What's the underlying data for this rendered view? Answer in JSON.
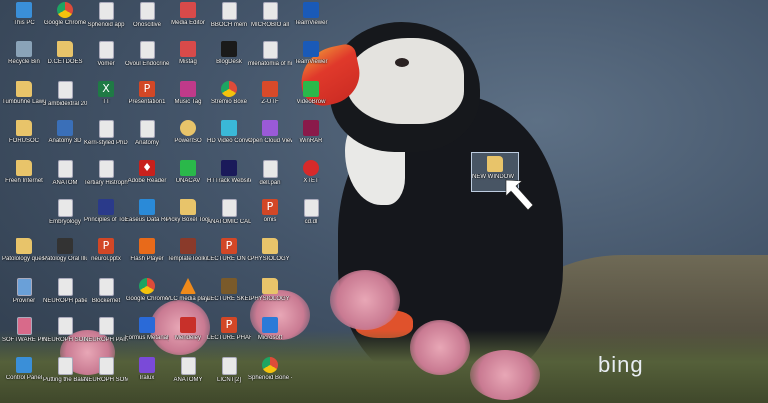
{
  "wallpaper": {
    "brand": "bing"
  },
  "icons": [
    {
      "label": "This PC",
      "icon": "computer-icon",
      "color": "#3a8fd8",
      "col": 0,
      "row": 0
    },
    {
      "label": "Recycle Bin",
      "icon": "recycle-bin-icon",
      "color": "#8aa3b8",
      "col": 0,
      "row": 1
    },
    {
      "label": "Tumbuhne Lawuse",
      "icon": "folder-icon",
      "color": "#e8c46a",
      "col": 0,
      "row": 2
    },
    {
      "label": "FORUSOC",
      "icon": "folder-icon",
      "color": "#e8c46a",
      "col": 0,
      "row": 3
    },
    {
      "label": "Freeh Internet",
      "icon": "folder-icon",
      "color": "#e8c46a",
      "col": 0,
      "row": 4
    },
    {
      "label": "Patolology questions",
      "icon": "folder-icon",
      "color": "#e8c46a",
      "col": 0,
      "row": 6
    },
    {
      "label": "Proviner",
      "icon": "document-icon",
      "color": "#6aa0d8",
      "col": 0,
      "row": 7
    },
    {
      "label": "SOFTWARE PHISC",
      "icon": "document-icon",
      "color": "#d86a8a",
      "col": 0,
      "row": 8
    },
    {
      "label": "Control Panel",
      "icon": "control-panel-icon",
      "color": "#3a8fd8",
      "col": 0,
      "row": 9
    },
    {
      "label": "Google Chrome",
      "icon": "chrome-icon",
      "color": "#dd4b39",
      "col": 1,
      "row": 0
    },
    {
      "label": "D.CETDOES",
      "icon": "folder-icon",
      "color": "#e8c46a",
      "col": 1,
      "row": 1
    },
    {
      "label": "3 ambidextral 2017",
      "icon": "document-icon",
      "color": "#e8e8e8",
      "col": 1,
      "row": 2
    },
    {
      "label": "Anatomy 3D",
      "icon": "app-icon",
      "color": "#3a6fb8",
      "col": 1,
      "row": 3
    },
    {
      "label": "ANATOM",
      "icon": "document-icon",
      "color": "#e8e8e8",
      "col": 1,
      "row": 4
    },
    {
      "label": "Embryology",
      "icon": "document-icon",
      "color": "#e8e8e8",
      "col": 1,
      "row": 5
    },
    {
      "label": "Patology Oral Illus copy",
      "icon": "image-icon",
      "color": "#333333",
      "col": 1,
      "row": 6
    },
    {
      "label": "NEUROPH patient",
      "icon": "document-icon",
      "color": "#e8e8e8",
      "col": 1,
      "row": 7
    },
    {
      "label": "NEUROPH SOMATIC",
      "icon": "document-icon",
      "color": "#e8e8e8",
      "col": 1,
      "row": 8
    },
    {
      "label": "Putting the Balance",
      "icon": "document-icon",
      "color": "#e8e8e8",
      "col": 1,
      "row": 9
    },
    {
      "label": "Sphenoid app",
      "icon": "document-icon",
      "color": "#e8e8e8",
      "col": 2,
      "row": 0
    },
    {
      "label": "Vomer",
      "icon": "document-icon",
      "color": "#e8e8e8",
      "col": 2,
      "row": 1
    },
    {
      "label": "TT",
      "icon": "excel-icon",
      "color": "#1f7a45",
      "col": 2,
      "row": 2
    },
    {
      "label": "Kerri-styled PhD stuff",
      "icon": "document-icon",
      "color": "#e8e8e8",
      "col": 2,
      "row": 3
    },
    {
      "label": "Tertiary Histrophy",
      "icon": "document-icon",
      "color": "#e8e8e8",
      "col": 2,
      "row": 4
    },
    {
      "label": "Principles of Toxicology",
      "icon": "image-icon",
      "color": "#2a3a8a",
      "col": 2,
      "row": 5
    },
    {
      "label": "neurol.pptx",
      "icon": "powerpoint-icon",
      "color": "#d24726",
      "col": 2,
      "row": 6
    },
    {
      "label": "Blockernet",
      "icon": "document-icon",
      "color": "#e8e8e8",
      "col": 2,
      "row": 7
    },
    {
      "label": "NEUROPH PAIN",
      "icon": "document-icon",
      "color": "#e8e8e8",
      "col": 2,
      "row": 8
    },
    {
      "label": "NEUROPH SOMATIC",
      "icon": "document-icon",
      "color": "#e8e8e8",
      "col": 2,
      "row": 9
    },
    {
      "label": "Onoscitive",
      "icon": "document-icon",
      "color": "#e8e8e8",
      "col": 3,
      "row": 0
    },
    {
      "label": "Ovoul Endocrine",
      "icon": "document-icon",
      "color": "#e8e8e8",
      "col": 3,
      "row": 1
    },
    {
      "label": "Presentation1",
      "icon": "powerpoint-icon",
      "color": "#d24726",
      "col": 3,
      "row": 2
    },
    {
      "label": "Anatomy",
      "icon": "document-icon",
      "color": "#e8e8e8",
      "col": 3,
      "row": 3
    },
    {
      "label": "Adobe Reader",
      "icon": "pdf-icon",
      "color": "#c8201c",
      "col": 3,
      "row": 4
    },
    {
      "label": "Easeus Data Recovery",
      "icon": "app-icon",
      "color": "#2a8ad8",
      "col": 3,
      "row": 5
    },
    {
      "label": "Flash Player",
      "icon": "app-icon",
      "color": "#e86a1a",
      "col": 3,
      "row": 6
    },
    {
      "label": "Google Chrome",
      "icon": "chrome-icon",
      "color": "#dd4b39",
      "col": 3,
      "row": 7
    },
    {
      "label": "Formus Metanalysis",
      "icon": "app-icon",
      "color": "#2a6ad8",
      "col": 3,
      "row": 8
    },
    {
      "label": "Iralux",
      "icon": "app-icon",
      "color": "#7a4ad8",
      "col": 3,
      "row": 9
    },
    {
      "label": "Media Editor",
      "icon": "app-icon",
      "color": "#d84a4a",
      "col": 4,
      "row": 0
    },
    {
      "label": "Mistag",
      "icon": "app-icon",
      "color": "#d84a4a",
      "col": 4,
      "row": 1
    },
    {
      "label": "Music Tag",
      "icon": "app-icon",
      "color": "#c03a8a",
      "col": 4,
      "row": 2
    },
    {
      "label": "PowerISO",
      "icon": "disc-icon",
      "color": "#e8c46a",
      "col": 4,
      "row": 3
    },
    {
      "label": "UNACAV",
      "icon": "app-icon",
      "color": "#2ab84a",
      "col": 4,
      "row": 4
    },
    {
      "label": "Picky Boxel Toolkits",
      "icon": "folder-icon",
      "color": "#e8c46a",
      "col": 4,
      "row": 5
    },
    {
      "label": "TemplateToolkit",
      "icon": "app-icon",
      "color": "#8a3a2a",
      "col": 4,
      "row": 6
    },
    {
      "label": "VLC media player",
      "icon": "vlc-icon",
      "color": "#f08a1a",
      "col": 4,
      "row": 7
    },
    {
      "label": "Mendeley",
      "icon": "app-icon",
      "color": "#c8302a",
      "col": 4,
      "row": 8
    },
    {
      "label": "ANATOMY",
      "icon": "document-icon",
      "color": "#e8e8e8",
      "col": 4,
      "row": 9
    },
    {
      "label": "BBOCH mem",
      "icon": "document-icon",
      "color": "#e8e8e8",
      "col": 5,
      "row": 0
    },
    {
      "label": "BlogDesk",
      "icon": "app-icon",
      "color": "#1a1a1a",
      "col": 5,
      "row": 1
    },
    {
      "label": "Stremio Boxe",
      "icon": "chrome-icon",
      "color": "#dd4b39",
      "col": 5,
      "row": 2
    },
    {
      "label": "HD Video Converter",
      "icon": "app-icon",
      "color": "#3ab8d8",
      "col": 5,
      "row": 3
    },
    {
      "label": "HTTrack Website",
      "icon": "app-icon",
      "color": "#1a1a5a",
      "col": 5,
      "row": 4
    },
    {
      "label": "ANATOMIC CALIT",
      "icon": "document-icon",
      "color": "#e8e8e8",
      "col": 5,
      "row": 5
    },
    {
      "label": "LECTURE ON OSTEOPATHY",
      "icon": "powerpoint-icon",
      "color": "#d24726",
      "col": 5,
      "row": 6
    },
    {
      "label": "LECTURE SKELETON",
      "icon": "image-icon",
      "color": "#7a5a2a",
      "col": 5,
      "row": 7
    },
    {
      "label": "LECTURE PHARMA",
      "icon": "powerpoint-icon",
      "color": "#d24726",
      "col": 5,
      "row": 8
    },
    {
      "label": "LICNT[2]",
      "icon": "document-icon",
      "color": "#e8e8e8",
      "col": 5,
      "row": 9
    },
    {
      "label": "MICROBIO all",
      "icon": "document-icon",
      "color": "#e8e8e8",
      "col": 6,
      "row": 0
    },
    {
      "label": "mlenatomia of human",
      "icon": "document-icon",
      "color": "#e8e8e8",
      "col": 6,
      "row": 1
    },
    {
      "label": "Z-UTF",
      "icon": "app-icon",
      "color": "#d84a2a",
      "col": 6,
      "row": 2
    },
    {
      "label": "Open Cloud Viewer",
      "icon": "app-icon",
      "color": "#9a5ad8",
      "col": 6,
      "row": 3
    },
    {
      "label": "dell.pan",
      "icon": "document-icon",
      "color": "#e8e8e8",
      "col": 6,
      "row": 4
    },
    {
      "label": "omis",
      "icon": "powerpoint-icon",
      "color": "#d24726",
      "col": 6,
      "row": 5
    },
    {
      "label": "PHYSIOLOGY",
      "icon": "folder-icon",
      "color": "#e8c46a",
      "col": 6,
      "row": 6
    },
    {
      "label": "PHYSIOLOGY",
      "icon": "folder-icon",
      "color": "#e8c46a",
      "col": 6,
      "row": 7
    },
    {
      "label": "Microsoft",
      "icon": "app-icon",
      "color": "#2a7ad8",
      "col": 6,
      "row": 8
    },
    {
      "label": "Sphenoid Bone - Lodi",
      "icon": "chrome-icon",
      "color": "#dd4b39",
      "col": 6,
      "row": 9
    },
    {
      "label": "TeamViewer",
      "icon": "app-icon",
      "color": "#1a5ab8",
      "col": 7,
      "row": 0
    },
    {
      "label": "TeamViewer",
      "icon": "app-icon",
      "color": "#1a5ab8",
      "col": 7,
      "row": 1
    },
    {
      "label": "VideoBrow",
      "icon": "app-icon",
      "color": "#2ab84a",
      "col": 7,
      "row": 2
    },
    {
      "label": "WinRAR",
      "icon": "winrar-icon",
      "color": "#8a1a4a",
      "col": 7,
      "row": 3
    },
    {
      "label": "XTET",
      "icon": "stop-icon",
      "color": "#d82a2a",
      "col": 7,
      "row": 4
    },
    {
      "label": "cd.dl",
      "icon": "document-icon",
      "color": "#e8e8e8",
      "col": 7,
      "row": 5
    }
  ],
  "selected_icon": {
    "label": "NEW WINDOW",
    "icon": "folder-icon",
    "color": "#e8c46a"
  }
}
